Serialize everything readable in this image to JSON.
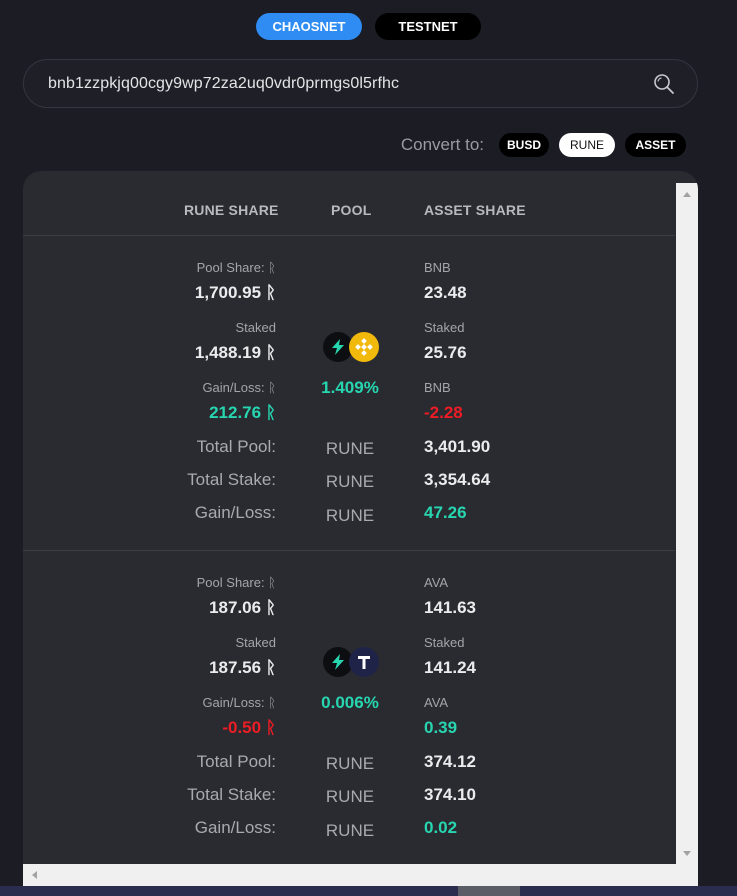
{
  "network": {
    "chaosnet": "CHAOSNET",
    "testnet": "TESTNET",
    "active": "chaosnet"
  },
  "search": {
    "value": "bnb1zzpkjq00cgy9wp72za2uq0vdr0prmgs0l5rfhc"
  },
  "convert": {
    "label": "Convert to:",
    "options": [
      "BUSD",
      "RUNE",
      "ASSET"
    ],
    "selected": "RUNE"
  },
  "table": {
    "headers": {
      "rune_share": "RUNE SHARE",
      "pool": "POOL",
      "asset_share": "ASSET SHARE"
    },
    "pools": [
      {
        "asset_icon": "bnb-coin-icon",
        "pool_share_label": "Pool Share: ᚱ",
        "pool_share_value": "1,700.95 ᚱ",
        "asset_label": "BNB",
        "asset_share_value": "23.48",
        "staked_label": "Staked",
        "rune_staked_value": "1,488.19 ᚱ",
        "asset_staked_label": "Staked",
        "asset_staked_value": "25.76",
        "gain_loss_label": "Gain/Loss: ᚱ",
        "rune_gain_value": "212.76 ᚱ",
        "pool_pct": "1.409%",
        "asset_gain_label": "BNB",
        "asset_gain_value": "-2.28",
        "total_pool_label": "Total Pool:",
        "total_pool_unit": "RUNE",
        "total_pool_value": "3,401.90",
        "total_stake_label": "Total Stake:",
        "total_stake_unit": "RUNE",
        "total_stake_value": "3,354.64",
        "total_gain_label": "Gain/Loss:",
        "total_gain_unit": "RUNE",
        "total_gain_value": "47.26"
      },
      {
        "asset_icon": "ava-t-coin-icon",
        "pool_share_label": "Pool Share: ᚱ",
        "pool_share_value": "187.06 ᚱ",
        "asset_label": "AVA",
        "asset_share_value": "141.63",
        "staked_label": "Staked",
        "rune_staked_value": "187.56 ᚱ",
        "asset_staked_label": "Staked",
        "asset_staked_value": "141.24",
        "gain_loss_label": "Gain/Loss: ᚱ",
        "rune_gain_value": "-0.50 ᚱ",
        "pool_pct": "0.006%",
        "asset_gain_label": "AVA",
        "asset_gain_value": "0.39",
        "total_pool_label": "Total Pool:",
        "total_pool_unit": "RUNE",
        "total_pool_value": "374.12",
        "total_stake_label": "Total Stake:",
        "total_stake_unit": "RUNE",
        "total_stake_value": "374.10",
        "total_gain_label": "Gain/Loss:",
        "total_gain_unit": "RUNE",
        "total_gain_value": "0.02"
      }
    ]
  },
  "colors": {
    "accent": "#2f8cf2",
    "gain": "#27d6b0",
    "loss": "#ee1c24",
    "panel": "#292b31",
    "background": "#1b1c24"
  }
}
